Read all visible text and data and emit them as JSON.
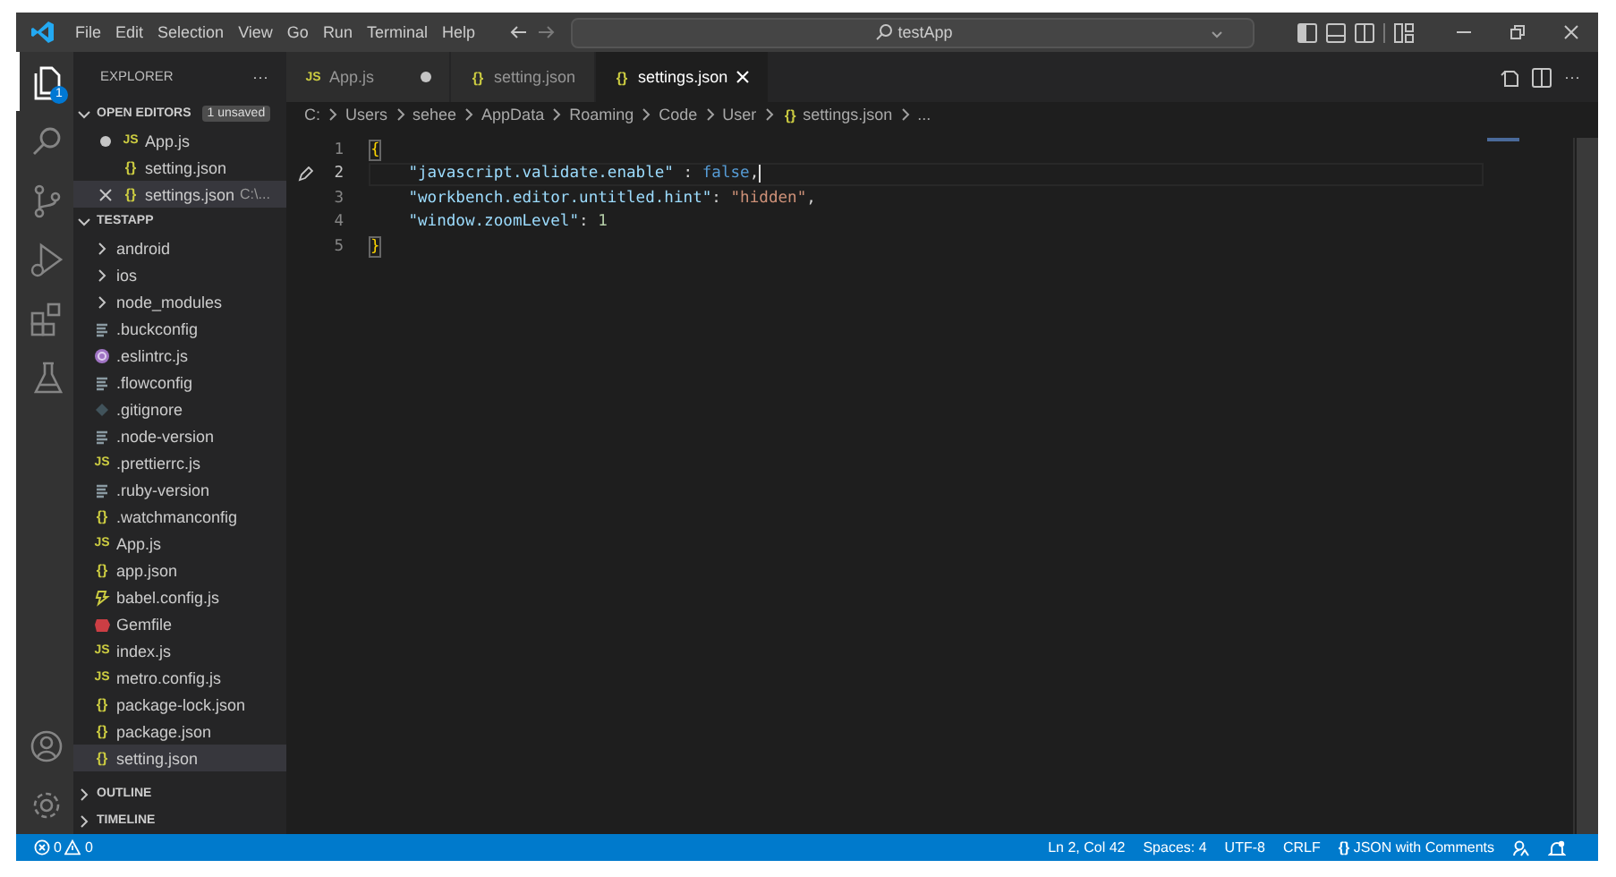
{
  "title_bar": {
    "menu": [
      "File",
      "Edit",
      "Selection",
      "View",
      "Go",
      "Run",
      "Terminal",
      "Help"
    ],
    "search": {
      "value": "testApp"
    }
  },
  "activity_bar": {
    "items": [
      {
        "kind": "explorer",
        "selected": true,
        "badge": "1"
      },
      {
        "kind": "search",
        "selected": false
      },
      {
        "kind": "source-control",
        "selected": false
      },
      {
        "kind": "run",
        "selected": false
      },
      {
        "kind": "extensions",
        "selected": false
      },
      {
        "kind": "testing",
        "selected": false
      }
    ],
    "bottom": [
      {
        "kind": "account"
      },
      {
        "kind": "settings"
      }
    ]
  },
  "sidebar": {
    "title": "EXPLORER",
    "more": "···",
    "open_editors": {
      "label": "OPEN EDITORS",
      "badge": "1 unsaved",
      "expanded": true,
      "items": [
        {
          "name": "App.js",
          "kind": "js",
          "icon": "JS",
          "dirty": true,
          "selected": false
        },
        {
          "name": "setting.json",
          "kind": "json",
          "icon": "{}",
          "dirty": false,
          "selected": false
        },
        {
          "name": "settings.json",
          "kind": "json",
          "icon": "{}",
          "dirty": false,
          "selected": true,
          "description": "C:\\..."
        }
      ]
    },
    "project": {
      "label": "TESTAPP",
      "expanded": true,
      "children": [
        {
          "name": "android",
          "kind": "folder"
        },
        {
          "name": "ios",
          "kind": "folder"
        },
        {
          "name": "node_modules",
          "kind": "folder"
        },
        {
          "name": ".buckconfig",
          "kind": "config",
          "selected": false
        },
        {
          "name": ".eslintrc.js",
          "kind": "eslint",
          "selected": false
        },
        {
          "name": ".flowconfig",
          "kind": "config",
          "selected": false
        },
        {
          "name": ".gitignore",
          "kind": "git",
          "selected": false
        },
        {
          "name": ".node-version",
          "kind": "config",
          "selected": false
        },
        {
          "name": ".prettierrc.js",
          "kind": "js",
          "icon": "JS",
          "selected": false
        },
        {
          "name": ".ruby-version",
          "kind": "config",
          "selected": false
        },
        {
          "name": ".watchmanconfig",
          "kind": "json",
          "icon": "{}",
          "selected": false
        },
        {
          "name": "App.js",
          "kind": "js",
          "icon": "JS",
          "selected": false
        },
        {
          "name": "app.json",
          "kind": "json",
          "icon": "{}",
          "selected": false
        },
        {
          "name": "babel.config.js",
          "kind": "babel",
          "selected": false
        },
        {
          "name": "Gemfile",
          "kind": "gem",
          "selected": false
        },
        {
          "name": "index.js",
          "kind": "js",
          "icon": "JS",
          "selected": false
        },
        {
          "name": "metro.config.js",
          "kind": "js",
          "icon": "JS",
          "selected": false
        },
        {
          "name": "package-lock.json",
          "kind": "json",
          "icon": "{}",
          "selected": false
        },
        {
          "name": "package.json",
          "kind": "json",
          "icon": "{}",
          "selected": false
        },
        {
          "name": "setting.json",
          "kind": "json",
          "icon": "{}",
          "selected": true
        }
      ]
    },
    "sections": [
      {
        "label": "OUTLINE",
        "expanded": false
      },
      {
        "label": "TIMELINE",
        "expanded": false
      }
    ]
  },
  "tabs": [
    {
      "label": "App.js",
      "kind": "js",
      "icon": "JS",
      "dirty": true,
      "selected": false
    },
    {
      "label": "setting.json",
      "kind": "json",
      "icon": "{}",
      "dirty": false,
      "selected": false
    },
    {
      "label": "settings.json",
      "kind": "json",
      "icon": "{}",
      "dirty": false,
      "selected": true
    }
  ],
  "tab_actions": {
    "more": "···"
  },
  "breadcrumb": [
    {
      "label": "C:"
    },
    {
      "label": "Users"
    },
    {
      "label": "sehee"
    },
    {
      "label": "AppData"
    },
    {
      "label": "Roaming"
    },
    {
      "label": "Code"
    },
    {
      "label": "User"
    },
    {
      "label": "settings.json",
      "kind": "json",
      "icon": "{}"
    },
    {
      "label": "..."
    }
  ],
  "editor": {
    "lines": [
      {
        "number": "1",
        "text": "{"
      },
      {
        "number": "2",
        "current": true,
        "modified": true,
        "text": "    \"javascript.validate.enable\" : false,"
      },
      {
        "number": "3",
        "text": "    \"workbench.editor.untitled.hint\": \"hidden\","
      },
      {
        "number": "4",
        "text": "    \"window.zoomLevel\": 1"
      },
      {
        "number": "5",
        "text": "}"
      }
    ]
  },
  "status_bar": {
    "errors": "0",
    "warnings": "0",
    "items": [
      {
        "kind": "text",
        "text": "Ln 2, Col 42"
      },
      {
        "kind": "text",
        "text": "Spaces: 4"
      },
      {
        "kind": "text",
        "text": "UTF-8"
      },
      {
        "kind": "text",
        "text": "CRLF"
      },
      {
        "kind": "language",
        "icon": "{}",
        "text": "JSON with Comments"
      },
      {
        "kind": "feedback"
      },
      {
        "kind": "bell"
      }
    ]
  }
}
